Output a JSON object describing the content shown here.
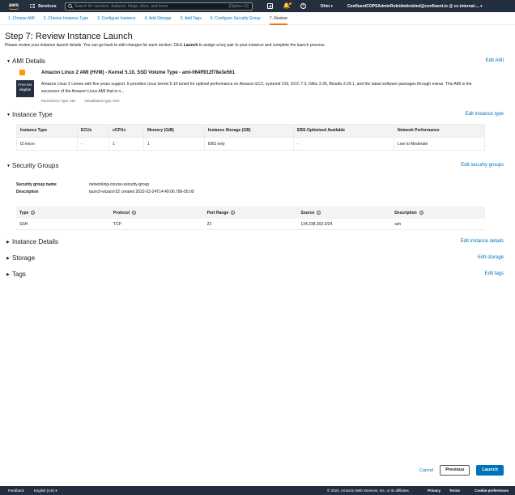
{
  "topnav": {
    "logo": "aws",
    "services_label": "Services",
    "search_placeholder": "Search for services, features, blogs, docs, and more",
    "search_shortcut": "[Option+S]",
    "region": "Ohio ▾",
    "account": "ConfluentCOPSAdminRole/dwitrobind@confluent.io @ cc-internal-... ▾"
  },
  "wizard": {
    "tabs": [
      {
        "label": "1. Choose AMI"
      },
      {
        "label": "2. Choose Instance Type"
      },
      {
        "label": "3. Configure Instance"
      },
      {
        "label": "4. Add Storage"
      },
      {
        "label": "5. Add Tags"
      },
      {
        "label": "6. Configure Security Group"
      },
      {
        "label": "7. Review"
      }
    ]
  },
  "page": {
    "title": "Step 7: Review Instance Launch",
    "desc_pre": "Please review your instance launch details. You can go back to edit changes for each section. Click ",
    "desc_bold": "Launch",
    "desc_post": " to assign a key pair to your instance and complete the launch process."
  },
  "ami": {
    "heading": "AMI Details",
    "edit": "Edit AMI",
    "name": "Amazon Linux 2 AMI (HVM) - Kernel 5.10, SSD Volume Type - ami-064ff912f78e3e561",
    "free_tier_1": "Free tier",
    "free_tier_2": "eligible",
    "description": "Amazon Linux 2 comes with five years support. It provides Linux kernel 5.10 tuned for optimal performance on Amazon EC2, systemd 219, GCC 7.3, Glibc 2.26, Binutils 2.29.1, and the latest software packages through extras. This AMI is the successor of the Amazon Linux AMI that is n...",
    "root_device": "Root Device Type: ebs",
    "virtualization": "Virtualization type: hvm"
  },
  "instance_type": {
    "heading": "Instance Type",
    "edit": "Edit instance type",
    "columns": [
      "Instance Type",
      "ECUs",
      "vCPUs",
      "Memory (GiB)",
      "Instance Storage (GB)",
      "EBS-Optimized Available",
      "Network Performance"
    ],
    "row": [
      "t2.micro",
      "-",
      "1",
      "1",
      "EBS only",
      "-",
      "Low to Moderate"
    ]
  },
  "security_groups": {
    "heading": "Security Groups",
    "edit": "Edit security groups",
    "name_label": "Security group name",
    "name_value": "networking-course-security-group",
    "desc_label": "Description",
    "desc_value": "launch-wizard-52 created 2022-03-24T14:49:06.786-05:00",
    "columns": [
      "Type",
      "Protocol",
      "Port Range",
      "Source",
      "Description"
    ],
    "row": [
      "SSH",
      "TCP",
      "22",
      "134.238.202.0/24",
      "ssh"
    ]
  },
  "collapsed": {
    "instance_details": {
      "heading": "Instance Details",
      "edit": "Edit instance details"
    },
    "storage": {
      "heading": "Storage",
      "edit": "Edit storage"
    },
    "tags": {
      "heading": "Tags",
      "edit": "Edit tags"
    }
  },
  "actions": {
    "cancel": "Cancel",
    "previous": "Previous",
    "launch": "Launch"
  },
  "footer": {
    "feedback": "Feedback",
    "language": "English (US) ▾",
    "copyright": "© 2022, Amazon Web Services, Inc. or its affiliates.",
    "privacy": "Privacy",
    "terms": "Terms",
    "cookies": "Cookie preferences"
  },
  "colors": {
    "nav_bg": "#232f3e",
    "link": "#0073bb",
    "accent": "#ec7211",
    "primary_button": "#0073bb"
  }
}
